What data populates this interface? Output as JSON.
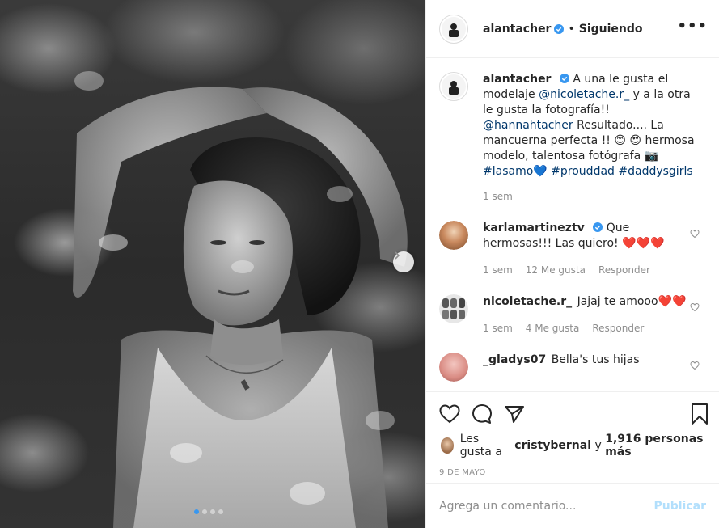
{
  "post": {
    "username": "alantacher",
    "separator": "•",
    "follow_status": "Siguiendo",
    "more_label": "•••"
  },
  "caption": {
    "username": "alantacher",
    "text_1": "A una le gusta el modelaje ",
    "mention_1": "@nicoletache.r_",
    "text_2": " y a la otra le gusta la fotografía!! ",
    "mention_2": "@hannahtacher",
    "text_3": " Resultado.... La mancuerna perfecta !! 😊 😍 hermosa modelo, talentosa fotógrafa 📷 ",
    "hashtag_1": "#lasamo",
    "heart": "💙",
    "hashtag_2": "#prouddad",
    "hashtag_3": "#daddysgirls",
    "time": "1 sem"
  },
  "comments": [
    {
      "username": "karlamartineztv",
      "text": "Que hermosas!!! Las quiero! ❤️❤️❤️",
      "time": "1 sem",
      "likes": "12 Me gusta",
      "reply": "Responder"
    },
    {
      "username": "nicoletache.r_",
      "text": "Jajaj te amooo❤️❤️",
      "time": "1 sem",
      "likes": "4 Me gusta",
      "reply": "Responder"
    },
    {
      "username": "_gladys07",
      "text": "Bella's tus hijas"
    }
  ],
  "likes": {
    "prefix": "Les gusta a",
    "user": "cristybernal",
    "conj": "y",
    "count": "1,916 personas más"
  },
  "date": "9 DE MAYO",
  "add_comment": {
    "placeholder": "Agrega un comentario...",
    "publish": "Publicar"
  },
  "colors": {
    "verified": "#3897f0",
    "link": "#00376b",
    "publish_disabled": "#b2dffc",
    "heart_red": "#c8102e"
  },
  "carousel": {
    "current": 1,
    "total": 4
  }
}
